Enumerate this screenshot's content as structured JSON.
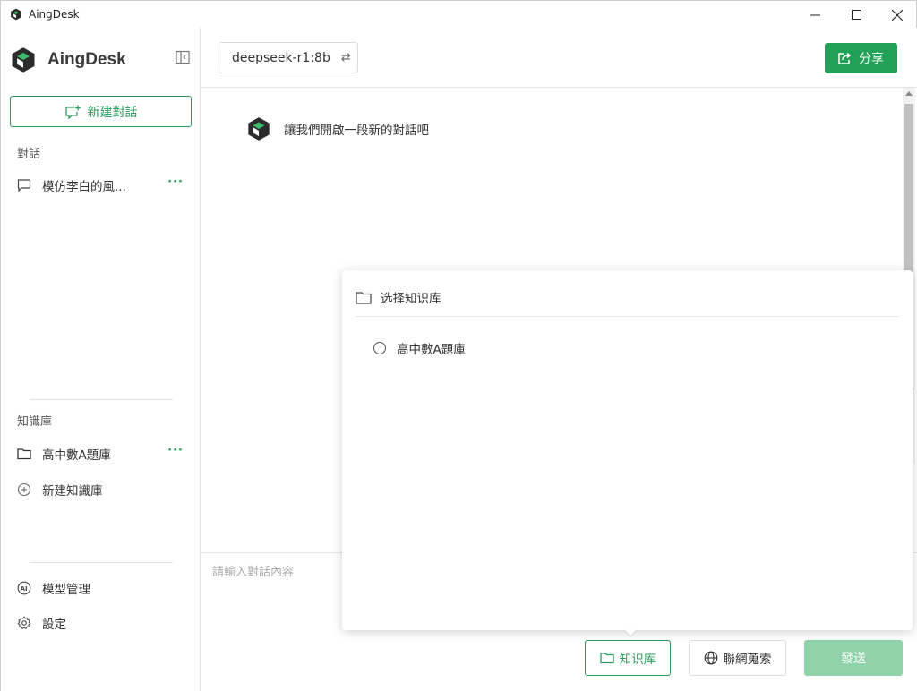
{
  "window": {
    "title": "AingDesk",
    "icons": {
      "minimize": "minimize-icon",
      "maximize": "maximize-icon",
      "close": "close-icon"
    }
  },
  "sidebar": {
    "logo_text": "AingDesk",
    "new_chat_label": "新建對話",
    "conversations_label": "對話",
    "conversations": [
      {
        "label": "模仿李白的風...",
        "icon": "chat-bubble-icon"
      }
    ],
    "knowledge_label": "知識庫",
    "knowledge_bases": [
      {
        "label": "高中數A題庫",
        "icon": "folder-icon"
      }
    ],
    "new_kb_label": "新建知識庫",
    "model_manage_label": "模型管理",
    "settings_label": "設定"
  },
  "header": {
    "model": "deepseek-r1:8b",
    "share_label": "分享"
  },
  "chat": {
    "bot_message": "讓我們開啟一段新的對話吧"
  },
  "input": {
    "placeholder": "請輸入對話內容",
    "kb_button": "知识库",
    "web_button": "聯網蒐索",
    "send_button": "發送"
  },
  "popover": {
    "title": "选择知识库",
    "options": [
      {
        "label": "高中數A題庫",
        "selected": false
      }
    ]
  },
  "colors": {
    "accent": "#21a157",
    "accent_border": "#2a9d5c",
    "send_disabled": "#90d3ab"
  }
}
